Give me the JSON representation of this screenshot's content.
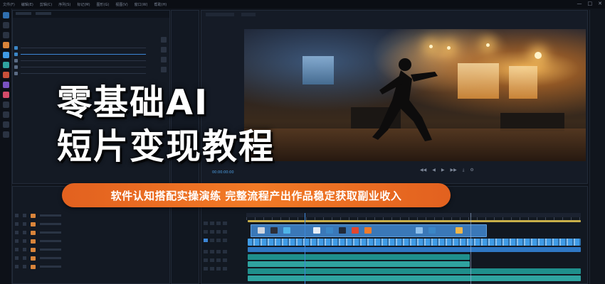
{
  "menubar": {
    "items": [
      "文件(F)",
      "编辑(E)",
      "剪辑(C)",
      "序列(S)",
      "标记(M)",
      "图形(G)",
      "视图(V)",
      "窗口(W)",
      "帮助(H)"
    ],
    "window_controls": [
      "—",
      "□",
      "✕"
    ]
  },
  "monitor": {
    "timecode": "00:00:00:00",
    "controls": [
      "◀◀",
      "◀",
      "▶",
      "▶▶",
      "⤓",
      "⚙"
    ]
  },
  "overlay": {
    "headline_line1": "零基础AI",
    "headline_line2": "短片变现教程",
    "banner": "软件认知搭配实操演练  完整流程产出作品稳定获取副业收入"
  },
  "colors": {
    "accent_orange": "#f27a26",
    "timeline_blue": "#3c86d6",
    "audio_teal": "#2fa3a0",
    "video_track": "#3f9be6",
    "background": "#10141c"
  },
  "icons": [
    "play-icon",
    "rewind-icon",
    "forward-icon",
    "export-icon",
    "settings-icon",
    "folder-icon",
    "scissors-icon"
  ]
}
